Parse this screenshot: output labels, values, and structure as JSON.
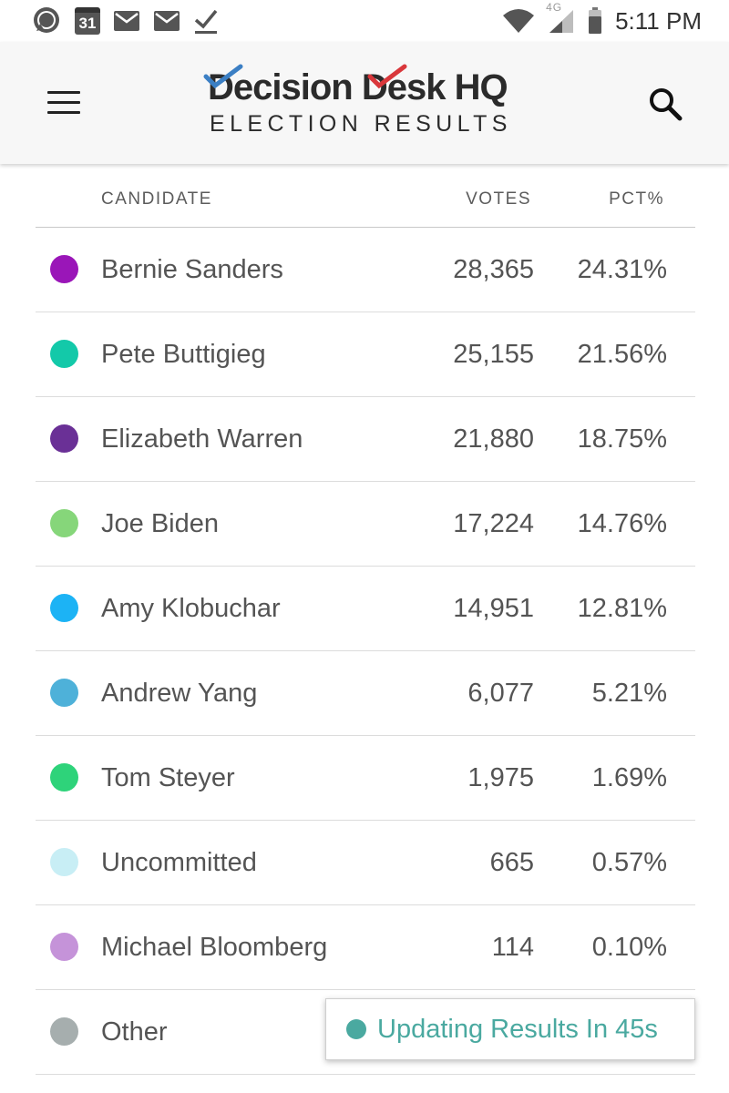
{
  "status_bar": {
    "time": "5:11 PM",
    "calendar_day": "31",
    "network_label": "4G",
    "icons": [
      "chat-bubble-icon",
      "calendar-icon",
      "mail-icon",
      "mail-icon",
      "download-check-icon",
      "wifi-icon",
      "signal-icon",
      "battery-icon"
    ]
  },
  "header": {
    "brand": "Decision Desk HQ",
    "subtitle": "ELECTION RESULTS",
    "menu_icon": "hamburger-icon",
    "search_icon": "search-icon",
    "brand_colors": {
      "check_blue": "#3b7fc4",
      "check_red": "#d9373b"
    }
  },
  "table": {
    "headers": {
      "candidate": "CANDIDATE",
      "votes": "VOTES",
      "pct": "PCT%"
    },
    "rows": [
      {
        "name": "Bernie Sanders",
        "votes": "28,365",
        "pct": "24.31%",
        "color": "#9a16b8"
      },
      {
        "name": "Pete Buttigieg",
        "votes": "25,155",
        "pct": "21.56%",
        "color": "#13c9a9"
      },
      {
        "name": "Elizabeth Warren",
        "votes": "21,880",
        "pct": "18.75%",
        "color": "#6a3096"
      },
      {
        "name": "Joe Biden",
        "votes": "17,224",
        "pct": "14.76%",
        "color": "#86d67a"
      },
      {
        "name": "Amy Klobuchar",
        "votes": "14,951",
        "pct": "12.81%",
        "color": "#1cb3f5"
      },
      {
        "name": "Andrew Yang",
        "votes": "6,077",
        "pct": "5.21%",
        "color": "#4eb1d9"
      },
      {
        "name": "Tom Steyer",
        "votes": "1,975",
        "pct": "1.69%",
        "color": "#2ed37a"
      },
      {
        "name": "Uncommitted",
        "votes": "665",
        "pct": "0.57%",
        "color": "#c8eef5"
      },
      {
        "name": "Michael Bloomberg",
        "votes": "114",
        "pct": "0.10%",
        "color": "#c593d9"
      },
      {
        "name": "Other",
        "votes": "",
        "pct": "",
        "color": "#a6aeae"
      }
    ]
  },
  "toast": {
    "text": "Updating Results In 45s",
    "color": "#4aa9a0"
  }
}
